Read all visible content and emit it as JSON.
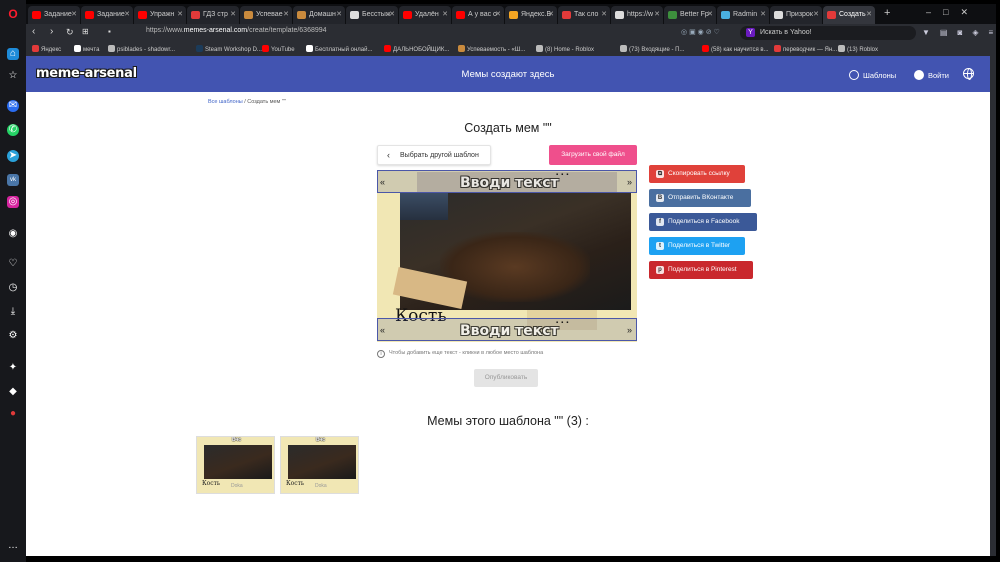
{
  "browser": {
    "tabs": [
      {
        "label": "Задание",
        "favicon_color": "#ff0000"
      },
      {
        "label": "Задание",
        "favicon_color": "#ff0000"
      },
      {
        "label": "Упражн",
        "favicon_color": "#ff0000"
      },
      {
        "label": "ГДЗ стр",
        "favicon_color": "#e23a3a"
      },
      {
        "label": "Успевае",
        "favicon_color": "#c98a3d"
      },
      {
        "label": "Домашн",
        "favicon_color": "#c98a3d"
      },
      {
        "label": "Бесстыж",
        "favicon_color": "#dddddd"
      },
      {
        "label": "Удалён",
        "favicon_color": "#ff0000"
      },
      {
        "label": "А у вас о",
        "favicon_color": "#ff0000"
      },
      {
        "label": "Яндекс.Б",
        "favicon_color": "#f5a623"
      },
      {
        "label": "Так сло",
        "favicon_color": "#e23a3a"
      },
      {
        "label": "https://w",
        "favicon_color": "#dddddd"
      },
      {
        "label": "Better Fp",
        "favicon_color": "#3d8f3d"
      },
      {
        "label": "Radmin",
        "favicon_color": "#4ab0e0"
      },
      {
        "label": "Призрок",
        "favicon_color": "#dddddd"
      },
      {
        "label": "Создать",
        "favicon_color": "#e23a3a"
      }
    ],
    "url_prefix": "https://www.",
    "url_domain": "memes-arsenal.com",
    "url_path": "/create/template/6368994",
    "search_placeholder": "Искать в Yahoo!",
    "bookmarks": [
      {
        "label": "Яндекс",
        "color": "#e23a3a"
      },
      {
        "label": "мечта",
        "color": "#ffffff"
      },
      {
        "label": "psiblades - shadowr...",
        "color": "#bbbbbb"
      },
      {
        "label": "Steam Workshop D...",
        "color": "#1b3b5a"
      },
      {
        "label": "YouTube",
        "color": "#ff0000"
      },
      {
        "label": "Бесплатный онлай...",
        "color": "#ffffff"
      },
      {
        "label": "ДАЛЬНОБОЙЩИК...",
        "color": "#ff0000"
      },
      {
        "label": "Успеваемость - «Ш...",
        "color": "#c98a3d"
      },
      {
        "label": "(8) Home - Roblox",
        "color": "#bbbbbb"
      },
      {
        "label": "(73) Входящие - П...",
        "color": "#bbbbbb"
      },
      {
        "label": "(58) как научится в...",
        "color": "#ff0000"
      },
      {
        "label": "переводчик — Ян...",
        "color": "#e23a3a"
      },
      {
        "label": "(13) Roblox",
        "color": "#bbbbbb"
      }
    ]
  },
  "site": {
    "logo": "meme-arsenal",
    "title": "Мемы создают здесь",
    "nav_templates": "Шаблоны",
    "nav_login": "Войти",
    "brand_color": "#4254b1"
  },
  "breadcrumb": {
    "all_templates": "Все шаблоны",
    "current": " / Создать мем \"\""
  },
  "editor": {
    "heading": "Создать мем \"\"",
    "other_template_button": "Выбрать другой шаблон",
    "upload_button": "Загрузить свой файл",
    "text_placeholder_top": "Вводи текст",
    "text_placeholder_bottom": "Вводи текст",
    "image_caption": "Кость",
    "hint": "Чтобы добавить еще текст - кликни в любое место шаблона",
    "publish_button": "Опубликовать"
  },
  "share": [
    {
      "label": "Скопировать ссылку",
      "color": "#e0413a",
      "icon": "copy-icon",
      "glyph": "⧉"
    },
    {
      "label": "Отправить ВКонтакте",
      "color": "#4a6fa0",
      "icon": "vk-icon",
      "glyph": "B"
    },
    {
      "label": "Поделиться в Facebook",
      "color": "#3b5998",
      "icon": "facebook-icon",
      "glyph": "f"
    },
    {
      "label": "Поделиться в Twitter",
      "color": "#1da1f2",
      "icon": "twitter-icon",
      "glyph": "t"
    },
    {
      "label": "Поделиться в Pinterest",
      "color": "#c9282d",
      "icon": "pinterest-icon",
      "glyph": "p"
    }
  ],
  "gallery": {
    "heading": "Мемы этого шаблона \"\" (3) :",
    "thumbs": [
      {
        "top_caption": "Вчс",
        "bottom_left": "Кость",
        "bottom_mid": "Doka"
      },
      {
        "top_caption": "Вчс",
        "bottom_left": "Кость",
        "bottom_mid": "Doka"
      }
    ]
  }
}
